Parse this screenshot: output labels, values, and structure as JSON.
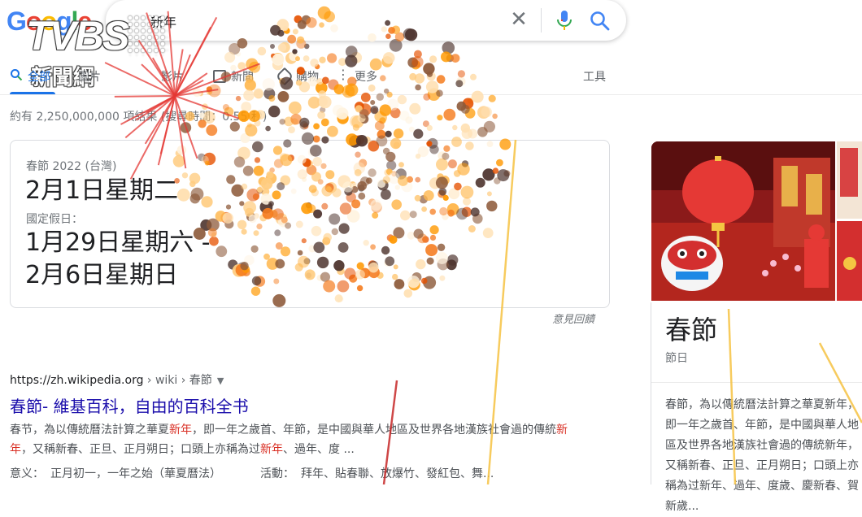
{
  "logo": "Google",
  "search": {
    "value": "新年"
  },
  "watermark": {
    "brand": "TVBS",
    "sub": "新聞網"
  },
  "tabs": [
    {
      "label": "全部",
      "icon": "search-icon",
      "active": true
    },
    {
      "label": "圖片",
      "icon": "image-icon"
    },
    {
      "label": "影片",
      "icon": "video-icon"
    },
    {
      "label": "新聞",
      "icon": "news-icon"
    },
    {
      "label": "購物",
      "icon": "tag-icon"
    },
    {
      "label": "更多",
      "icon": "more-icon"
    }
  ],
  "tools_label": "工具",
  "stats": "約有 2,250,000,000 項結果 (搜尋時間：0.55 秒)",
  "answer_card": {
    "caption": "春節 2022 (台灣)",
    "date": "2月1日星期二",
    "holiday_caption": "國定假日：",
    "holiday_range_line1": "1月29日星期六 -",
    "holiday_range_line2": "2月6日星期日",
    "feedback": "意見回饋"
  },
  "result": {
    "url_domain": "https://zh.wikipedia.org",
    "url_path": " › wiki › 春節",
    "title": "春節- 維基百科，自由的百科全书",
    "snippet": [
      {
        "text": "春节，為以傳統曆法計算之華夏",
        "hl": false
      },
      {
        "text": "新年",
        "hl": true
      },
      {
        "text": "，即一年之歲首、年節，是中國與華人地區及世界各地漢族社會過的傳統",
        "hl": false
      },
      {
        "text": "新年",
        "hl": true
      },
      {
        "text": "，又稱新春、正旦、正月朔日；口頭上亦稱為过",
        "hl": false
      },
      {
        "text": "新年",
        "hl": true
      },
      {
        "text": "、過年、度 ...",
        "hl": false
      }
    ],
    "attr1_label": "意义：",
    "attr1_value": "正月初一，一年之始（華夏曆法）",
    "attr2_label": "活動：",
    "attr2_value": "拜年、貼春聯、放爆竹、發紅包、舞..."
  },
  "knowledge_panel": {
    "title": "春節",
    "subtitle": "節日",
    "description": "春節，為以傳統曆法計算之華夏新年，即一年之歲首、年節，是中國與華人地區及世界各地漢族社會過的傳統新年，又稱新春、正旦、正月朔日；口頭上亦稱為过新年、過年、度歲、慶新春、賀新歲..."
  },
  "colors": {
    "accent": "#1a73e8",
    "link": "#1a0dab",
    "highlight": "#d93025",
    "firework_orange": "#f57c1f",
    "firework_red": "#c62828"
  }
}
